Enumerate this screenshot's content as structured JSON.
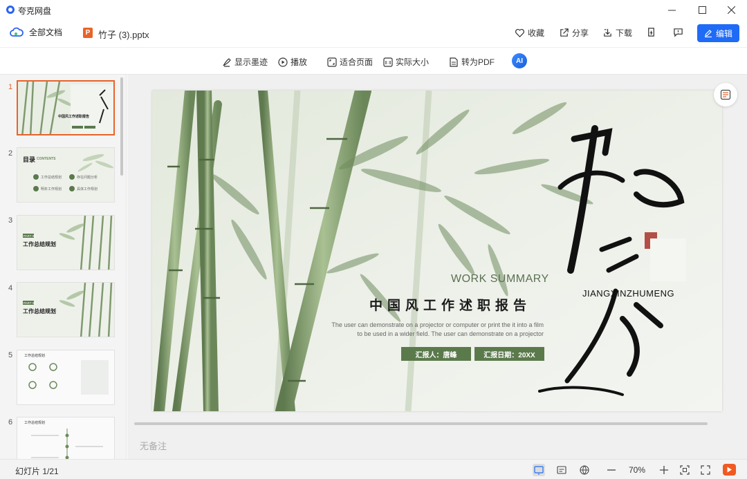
{
  "app": {
    "title": "夸克网盘"
  },
  "window": {
    "minimize": "—",
    "maximize": "☐",
    "close": "✕"
  },
  "docbar": {
    "all_docs": "全部文档",
    "file_icon": "P",
    "file_name": "竹子 (3).pptx",
    "favorite": "收藏",
    "share": "分享",
    "download": "下载",
    "edit": "编辑"
  },
  "toolbar": {
    "ink": "显示墨迹",
    "play": "播放",
    "fit_page": "适合页面",
    "actual_size": "实际大小",
    "to_pdf": "转为PDF",
    "ai_label": "AI"
  },
  "thumbnails": [
    {
      "num": "1",
      "title": "中国风工作述职报告"
    },
    {
      "num": "2",
      "title": "目录",
      "subtitle": "CONTENTS",
      "items": [
        "工作总结规划",
        "存在问题分析",
        "明年工作规划",
        "具体工作规划"
      ]
    },
    {
      "num": "3",
      "part": "PART 01",
      "title": "工作总结规划"
    },
    {
      "num": "4",
      "part": "PART 01",
      "title": "工作总结规划"
    },
    {
      "num": "5",
      "title": "工作总结规划"
    },
    {
      "num": "6",
      "title": "工作总结规划"
    }
  ],
  "slide": {
    "work_summary": "WORK SUMMARY",
    "title": "中国风工作述职报告",
    "desc_line1": "The user can demonstrate on a projector or computer or print the it into a film",
    "desc_line2": "to be used in a wider field. The user can demonstrate on a projector",
    "reporter": "汇报人：唐峰",
    "report_date": "汇报日期：20XX",
    "pinyin": "JIANGXINZHUMENG",
    "calligraphy": "匠心筑梦",
    "seal": "印"
  },
  "notes": {
    "placeholder": "无备注"
  },
  "statusbar": {
    "slide_counter": "幻灯片 1/21",
    "zoom": "70%"
  },
  "colors": {
    "accent": "#1f6bf5",
    "ppt_orange": "#e8632a",
    "bamboo_green": "#5b7a4c"
  }
}
